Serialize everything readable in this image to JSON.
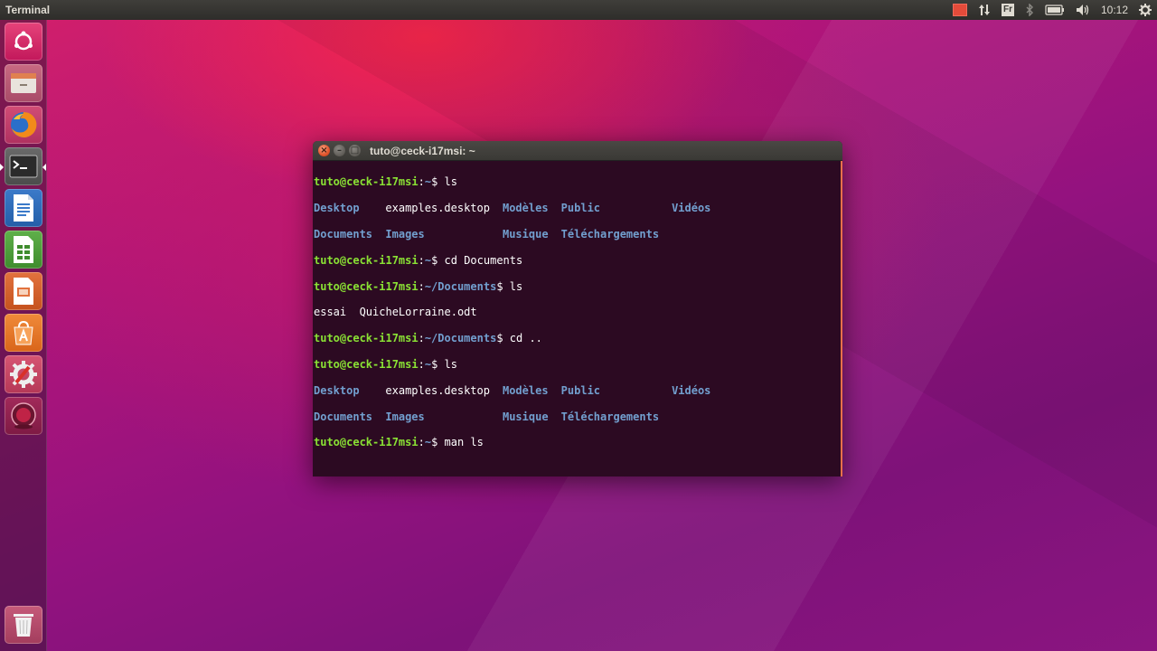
{
  "panel": {
    "app_title": "Terminal",
    "keyboard_layout": "Fr",
    "clock": "10:12"
  },
  "launcher": {
    "items": [
      {
        "name": "dash-home-icon"
      },
      {
        "name": "files-icon"
      },
      {
        "name": "firefox-icon"
      },
      {
        "name": "terminal-icon"
      },
      {
        "name": "writer-icon"
      },
      {
        "name": "calc-icon"
      },
      {
        "name": "impress-icon"
      },
      {
        "name": "software-center-icon"
      },
      {
        "name": "system-settings-icon"
      },
      {
        "name": "recorder-icon"
      },
      {
        "name": "trash-icon"
      }
    ]
  },
  "terminal": {
    "title": "tuto@ceck-i17msi: ~",
    "user_host": "tuto@ceck-i17msi",
    "home_path": "~",
    "documents_path": "~/Documents",
    "commands": {
      "ls": "ls",
      "cd_documents": "cd Documents",
      "cd_up": "cd ..",
      "man_ls": "man ls"
    },
    "home_listing": {
      "row1": [
        "Desktop",
        "examples.desktop",
        "Modèles",
        "Public",
        "Vidéos"
      ],
      "row2": [
        "Documents",
        "Images",
        "Musique",
        "Téléchargements"
      ]
    },
    "documents_listing": [
      "essai",
      "QuicheLorraine.odt"
    ]
  },
  "colors": {
    "prompt": "#8ae234",
    "directory": "#729fcf",
    "terminal_bg": "#2c0a22",
    "close_button": "#e0552c"
  }
}
